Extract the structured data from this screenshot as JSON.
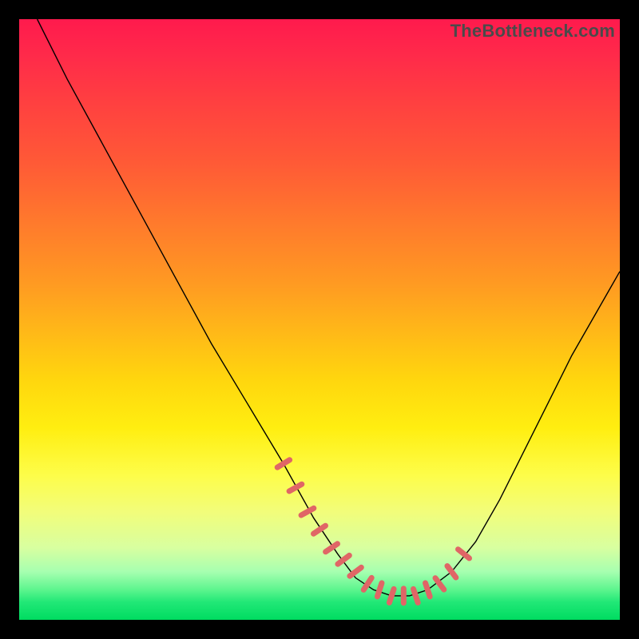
{
  "watermark": "TheBottleneck.com",
  "colors": {
    "tick": "#e06666",
    "curve": "#000000"
  },
  "chart_data": {
    "type": "line",
    "title": "",
    "xlabel": "",
    "ylabel": "",
    "xlim": [
      0,
      100
    ],
    "ylim": [
      0,
      100
    ],
    "series": [
      {
        "name": "curve",
        "x": [
          3,
          8,
          14,
          20,
          26,
          32,
          38,
          44,
          49,
          53,
          56,
          59,
          62,
          65,
          68,
          72,
          76,
          80,
          84,
          88,
          92,
          96,
          100
        ],
        "y": [
          100,
          90,
          79,
          68,
          57,
          46,
          36,
          26,
          17,
          11,
          7,
          5,
          4,
          4,
          5,
          8,
          13,
          20,
          28,
          36,
          44,
          51,
          58
        ]
      }
    ],
    "ticks": {
      "note": "short salmon tick marks along the curve near the valley, roughly perpendicular to the curve",
      "points_x": [
        44,
        46,
        48,
        50,
        52,
        54,
        56,
        58,
        60,
        62,
        64,
        66,
        68,
        70,
        72,
        74
      ],
      "approx_y": [
        26,
        22,
        18,
        15,
        12,
        10,
        8,
        6,
        5,
        4,
        4,
        4,
        5,
        6,
        8,
        11
      ]
    }
  }
}
